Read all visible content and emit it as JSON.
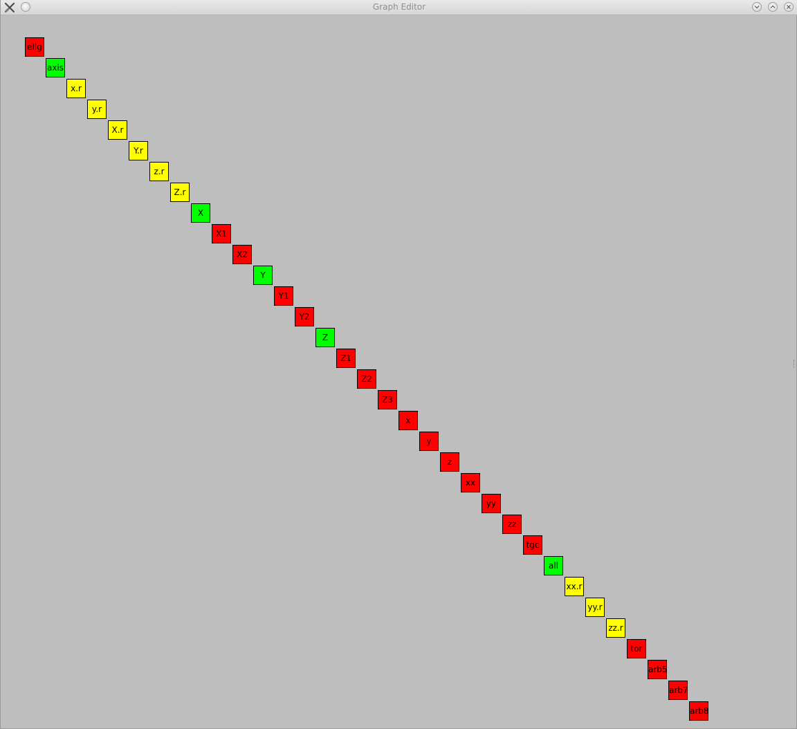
{
  "window": {
    "title": "Graph Editor",
    "controls": {
      "app_icon": "x-tools-icon",
      "sticky_icon": "circle-icon",
      "minimize_icon": "chevron-down-icon",
      "maximize_icon": "chevron-up-icon",
      "close_icon": "close-icon"
    }
  },
  "colors": {
    "red": "#ff0000",
    "green": "#00ff00",
    "yellow": "#ffff00",
    "background": "#bebebe"
  },
  "graph": {
    "nodes": [
      {
        "label": "ellg",
        "color": "red"
      },
      {
        "label": "axis",
        "color": "green"
      },
      {
        "label": "x.r",
        "color": "yellow"
      },
      {
        "label": "y.r",
        "color": "yellow"
      },
      {
        "label": "X.r",
        "color": "yellow"
      },
      {
        "label": "Y.r",
        "color": "yellow"
      },
      {
        "label": "z.r",
        "color": "yellow"
      },
      {
        "label": "Z.r",
        "color": "yellow"
      },
      {
        "label": "X",
        "color": "green"
      },
      {
        "label": "X1",
        "color": "red"
      },
      {
        "label": "X2",
        "color": "red"
      },
      {
        "label": "Y",
        "color": "green"
      },
      {
        "label": "Y1",
        "color": "red"
      },
      {
        "label": "Y2",
        "color": "red"
      },
      {
        "label": "Z",
        "color": "green"
      },
      {
        "label": "Z1",
        "color": "red"
      },
      {
        "label": "Z2",
        "color": "red"
      },
      {
        "label": "Z3",
        "color": "red"
      },
      {
        "label": "x",
        "color": "red"
      },
      {
        "label": "y",
        "color": "red"
      },
      {
        "label": "z",
        "color": "red"
      },
      {
        "label": "xx",
        "color": "red"
      },
      {
        "label": "yy",
        "color": "red"
      },
      {
        "label": "zz",
        "color": "red"
      },
      {
        "label": "tgc",
        "color": "red"
      },
      {
        "label": "all",
        "color": "green"
      },
      {
        "label": "xx.r",
        "color": "yellow"
      },
      {
        "label": "yy.r",
        "color": "yellow"
      },
      {
        "label": "zz.r",
        "color": "yellow"
      },
      {
        "label": "tor",
        "color": "red"
      },
      {
        "label": "arb5",
        "color": "red"
      },
      {
        "label": "arb7",
        "color": "red"
      },
      {
        "label": "arb8",
        "color": "red"
      }
    ]
  }
}
